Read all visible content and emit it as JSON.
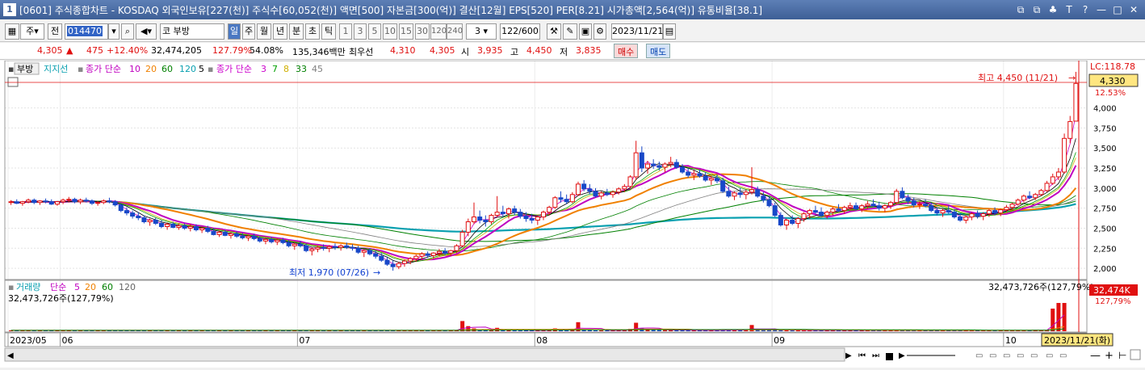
{
  "window": {
    "title": "[0601] 주식종합차트 - KOSDAQ 외국인보유[227(천)] 주식수[60,052(천)] 액면[500] 자본금[300(억)] 결산[12월] EPS[520] PER[8.21] 시가총액[2,564(억)] 유통비율[38.1]",
    "icon_label": "1",
    "buttons": [
      "⧉",
      "⧉",
      "♣",
      "T",
      "?",
      "—",
      "□",
      "✕"
    ]
  },
  "toolbar": {
    "chart_type": "주",
    "scope": "전",
    "code": "014470",
    "name_prefix": "코",
    "name": "부방",
    "periods": [
      "일",
      "주",
      "월",
      "년",
      "분",
      "초",
      "틱"
    ],
    "active_period": "일",
    "intervals": [
      "1",
      "3",
      "5",
      "10",
      "15",
      "30",
      "120",
      "240"
    ],
    "interval_value": "3",
    "count": "122",
    "count_total": "/600",
    "date": "2023/11/21"
  },
  "quote": {
    "price": "4,305",
    "arrow": "▲",
    "change": "475",
    "rate": "+12.40%",
    "volume": "32,474,205",
    "vol_rate": "127.79%",
    "ratio": "54.08%",
    "amount": "135,346백만",
    "pref_label": "최우선",
    "ask": "4,310",
    "bid": "4,305",
    "open_label": "시",
    "open": "3,935",
    "high_label": "고",
    "high": "4,450",
    "low_label": "저",
    "low": "3,835",
    "buy": "매수",
    "sell": "매도"
  },
  "legend": {
    "name": "부방",
    "support": "지지선",
    "ma1_title": "종가 단순",
    "ma1_periods": [
      "10",
      "20",
      "60",
      "120",
      "5"
    ],
    "ma2_title": "종가 단순",
    "ma2_periods": [
      "3",
      "7",
      "8",
      "33",
      "45"
    ]
  },
  "annotations": {
    "high": "최고 4,450 (11/21)",
    "low": "최저 1,970 (07/26)",
    "lc": "LC:118.78",
    "price_tag": "4,330",
    "pct": "12.53%",
    "vol_value": "32,473,726주(127,79%)",
    "vol_tag": "32,474K",
    "vol_pct": "127,79%",
    "cursor_date": "2023/11/21(화)"
  },
  "volume_panel": {
    "title": "거래량",
    "ma_title": "단순",
    "periods": [
      "5",
      "20",
      "60",
      "120"
    ],
    "readout": "32,473,726주(127,79%)"
  },
  "colors": {
    "up": "#e01010",
    "down": "#1848c8",
    "ma5": "#000000",
    "ma10": "#c000c0",
    "ma20": "#f08000",
    "ma60": "#008000",
    "ma120": "#0aa0b0",
    "ma_thin1": "#cc00cc",
    "ma_thin2": "#00a000",
    "ma_thin3": "#d0b000",
    "ma_thin4": "#008000",
    "ma_thin5": "#808080"
  },
  "chart_data": {
    "type": "candlestick",
    "y_ticks": [
      "4,000",
      "3,750",
      "3,500",
      "3,250",
      "3,000",
      "2,750",
      "2,500",
      "2,250",
      "2,000"
    ],
    "y_values": [
      4000,
      3750,
      3500,
      3250,
      3000,
      2750,
      2500,
      2250,
      2000
    ],
    "ylim": [
      1890,
      4560
    ],
    "x_labels": [
      "2023/05",
      "06",
      "07",
      "08",
      "09",
      "10",
      "11"
    ],
    "x_label_index": [
      0,
      9,
      50,
      91,
      132,
      172,
      208
    ],
    "candles": [
      [
        2820,
        2850,
        2790,
        2830
      ],
      [
        2830,
        2860,
        2800,
        2810
      ],
      [
        2810,
        2840,
        2780,
        2830
      ],
      [
        2830,
        2870,
        2810,
        2850
      ],
      [
        2850,
        2870,
        2800,
        2820
      ],
      [
        2820,
        2850,
        2790,
        2840
      ],
      [
        2840,
        2870,
        2810,
        2830
      ],
      [
        2830,
        2860,
        2790,
        2800
      ],
      [
        2800,
        2840,
        2780,
        2830
      ],
      [
        2830,
        2870,
        2800,
        2850
      ],
      [
        2850,
        2890,
        2820,
        2860
      ],
      [
        2860,
        2880,
        2810,
        2830
      ],
      [
        2830,
        2870,
        2800,
        2850
      ],
      [
        2850,
        2880,
        2820,
        2840
      ],
      [
        2840,
        2860,
        2790,
        2810
      ],
      [
        2810,
        2840,
        2780,
        2820
      ],
      [
        2820,
        2860,
        2800,
        2840
      ],
      [
        2840,
        2880,
        2810,
        2830
      ],
      [
        2830,
        2850,
        2770,
        2790
      ],
      [
        2790,
        2810,
        2700,
        2720
      ],
      [
        2720,
        2760,
        2660,
        2690
      ],
      [
        2690,
        2720,
        2620,
        2650
      ],
      [
        2650,
        2700,
        2600,
        2630
      ],
      [
        2630,
        2660,
        2560,
        2580
      ],
      [
        2580,
        2620,
        2530,
        2600
      ],
      [
        2600,
        2630,
        2540,
        2560
      ],
      [
        2560,
        2600,
        2500,
        2520
      ],
      [
        2520,
        2570,
        2480,
        2550
      ],
      [
        2550,
        2580,
        2500,
        2510
      ],
      [
        2510,
        2560,
        2480,
        2530
      ],
      [
        2530,
        2560,
        2480,
        2500
      ],
      [
        2500,
        2550,
        2460,
        2520
      ],
      [
        2520,
        2550,
        2460,
        2480
      ],
      [
        2480,
        2520,
        2440,
        2500
      ],
      [
        2500,
        2530,
        2440,
        2460
      ],
      [
        2460,
        2500,
        2410,
        2420
      ],
      [
        2420,
        2470,
        2390,
        2450
      ],
      [
        2450,
        2480,
        2400,
        2410
      ],
      [
        2410,
        2450,
        2370,
        2430
      ],
      [
        2430,
        2460,
        2380,
        2400
      ],
      [
        2400,
        2440,
        2360,
        2380
      ],
      [
        2380,
        2420,
        2340,
        2400
      ],
      [
        2400,
        2430,
        2350,
        2370
      ],
      [
        2370,
        2400,
        2320,
        2340
      ],
      [
        2340,
        2380,
        2300,
        2360
      ],
      [
        2360,
        2390,
        2310,
        2330
      ],
      [
        2330,
        2370,
        2290,
        2350
      ],
      [
        2350,
        2380,
        2300,
        2320
      ],
      [
        2320,
        2350,
        2260,
        2280
      ],
      [
        2280,
        2320,
        2230,
        2300
      ],
      [
        2300,
        2340,
        2260,
        2280
      ],
      [
        2280,
        2310,
        2200,
        2220
      ],
      [
        2220,
        2260,
        2160,
        2240
      ],
      [
        2240,
        2280,
        2200,
        2260
      ],
      [
        2260,
        2300,
        2220,
        2250
      ],
      [
        2250,
        2290,
        2200,
        2270
      ],
      [
        2270,
        2310,
        2230,
        2260
      ],
      [
        2260,
        2300,
        2220,
        2280
      ],
      [
        2280,
        2320,
        2240,
        2260
      ],
      [
        2260,
        2300,
        2220,
        2250
      ],
      [
        2250,
        2280,
        2180,
        2200
      ],
      [
        2200,
        2240,
        2140,
        2220
      ],
      [
        2220,
        2250,
        2160,
        2180
      ],
      [
        2180,
        2220,
        2120,
        2150
      ],
      [
        2150,
        2190,
        2080,
        2100
      ],
      [
        2100,
        2140,
        2030,
        2050
      ],
      [
        2050,
        2100,
        1970,
        2020
      ],
      [
        2020,
        2080,
        1990,
        2060
      ],
      [
        2060,
        2110,
        2020,
        2090
      ],
      [
        2090,
        2140,
        2050,
        2120
      ],
      [
        2120,
        2170,
        2080,
        2150
      ],
      [
        2150,
        2200,
        2110,
        2180
      ],
      [
        2180,
        2210,
        2130,
        2160
      ],
      [
        2160,
        2200,
        2120,
        2190
      ],
      [
        2190,
        2240,
        2150,
        2210
      ],
      [
        2210,
        2250,
        2160,
        2190
      ],
      [
        2190,
        2230,
        2150,
        2220
      ],
      [
        2220,
        2300,
        2190,
        2280
      ],
      [
        2280,
        2480,
        2260,
        2450
      ],
      [
        2450,
        2620,
        2400,
        2580
      ],
      [
        2580,
        2820,
        2550,
        2640
      ],
      [
        2640,
        2720,
        2560,
        2600
      ],
      [
        2600,
        2660,
        2520,
        2580
      ],
      [
        2580,
        2680,
        2550,
        2660
      ],
      [
        2660,
        2900,
        2640,
        2700
      ],
      [
        2700,
        2780,
        2640,
        2680
      ],
      [
        2680,
        2760,
        2620,
        2740
      ],
      [
        2740,
        2780,
        2660,
        2700
      ],
      [
        2700,
        2740,
        2620,
        2650
      ],
      [
        2650,
        2700,
        2580,
        2620
      ],
      [
        2620,
        2680,
        2560,
        2600
      ],
      [
        2600,
        2660,
        2540,
        2640
      ],
      [
        2640,
        2720,
        2600,
        2700
      ],
      [
        2700,
        2780,
        2660,
        2760
      ],
      [
        2760,
        2900,
        2740,
        2880
      ],
      [
        2880,
        2960,
        2820,
        2860
      ],
      [
        2860,
        2920,
        2800,
        2830
      ],
      [
        2830,
        2950,
        2810,
        2920
      ],
      [
        2920,
        3080,
        2900,
        3050
      ],
      [
        3050,
        3100,
        2960,
        2990
      ],
      [
        2990,
        3050,
        2920,
        2960
      ],
      [
        2960,
        3000,
        2880,
        2900
      ],
      [
        2900,
        2960,
        2860,
        2940
      ],
      [
        2940,
        2990,
        2900,
        2920
      ],
      [
        2920,
        2970,
        2880,
        2950
      ],
      [
        2950,
        3010,
        2920,
        2990
      ],
      [
        2990,
        3050,
        2950,
        3020
      ],
      [
        3020,
        3160,
        3000,
        3140
      ],
      [
        3140,
        3590,
        3100,
        3440
      ],
      [
        3440,
        3520,
        3200,
        3250
      ],
      [
        3250,
        3340,
        3180,
        3300
      ],
      [
        3300,
        3360,
        3240,
        3280
      ],
      [
        3280,
        3330,
        3220,
        3260
      ],
      [
        3260,
        3320,
        3200,
        3300
      ],
      [
        3300,
        3390,
        3260,
        3320
      ],
      [
        3320,
        3360,
        3240,
        3260
      ],
      [
        3260,
        3300,
        3180,
        3200
      ],
      [
        3200,
        3250,
        3130,
        3160
      ],
      [
        3160,
        3220,
        3100,
        3180
      ],
      [
        3180,
        3230,
        3130,
        3150
      ],
      [
        3150,
        3200,
        3080,
        3100
      ],
      [
        3100,
        3150,
        3040,
        3120
      ],
      [
        3120,
        3170,
        3060,
        3090
      ],
      [
        3090,
        3130,
        2940,
        2960
      ],
      [
        2960,
        3020,
        2880,
        2900
      ],
      [
        2900,
        2960,
        2850,
        2940
      ],
      [
        2940,
        3000,
        2880,
        2920
      ],
      [
        2920,
        2980,
        2860,
        2950
      ],
      [
        2950,
        3260,
        2920,
        2980
      ],
      [
        2980,
        3020,
        2880,
        2900
      ],
      [
        2900,
        2950,
        2820,
        2850
      ],
      [
        2850,
        2900,
        2760,
        2780
      ],
      [
        2780,
        2820,
        2640,
        2660
      ],
      [
        2660,
        2700,
        2520,
        2540
      ],
      [
        2540,
        2620,
        2480,
        2600
      ],
      [
        2600,
        2660,
        2540,
        2560
      ],
      [
        2560,
        2640,
        2500,
        2620
      ],
      [
        2620,
        2700,
        2580,
        2680
      ],
      [
        2680,
        2740,
        2620,
        2720
      ],
      [
        2720,
        2780,
        2680,
        2700
      ],
      [
        2700,
        2760,
        2640,
        2660
      ],
      [
        2660,
        2720,
        2620,
        2700
      ],
      [
        2700,
        2760,
        2660,
        2740
      ],
      [
        2740,
        2800,
        2700,
        2720
      ],
      [
        2720,
        2780,
        2680,
        2760
      ],
      [
        2760,
        2820,
        2720,
        2780
      ],
      [
        2780,
        2820,
        2720,
        2740
      ],
      [
        2740,
        2800,
        2700,
        2780
      ],
      [
        2780,
        2840,
        2740,
        2800
      ],
      [
        2800,
        2860,
        2760,
        2780
      ],
      [
        2780,
        2830,
        2720,
        2750
      ],
      [
        2750,
        2800,
        2700,
        2780
      ],
      [
        2780,
        2840,
        2740,
        2820
      ],
      [
        2820,
        2990,
        2800,
        2960
      ],
      [
        2960,
        3010,
        2860,
        2880
      ],
      [
        2880,
        2920,
        2800,
        2840
      ],
      [
        2840,
        2880,
        2760,
        2790
      ],
      [
        2790,
        2840,
        2740,
        2800
      ],
      [
        2800,
        2860,
        2760,
        2780
      ],
      [
        2780,
        2820,
        2700,
        2720
      ],
      [
        2720,
        2760,
        2660,
        2690
      ],
      [
        2690,
        2740,
        2640,
        2720
      ],
      [
        2720,
        2780,
        2680,
        2700
      ],
      [
        2700,
        2740,
        2620,
        2640
      ],
      [
        2640,
        2680,
        2580,
        2600
      ],
      [
        2600,
        2660,
        2560,
        2640
      ],
      [
        2640,
        2700,
        2600,
        2680
      ],
      [
        2680,
        2720,
        2620,
        2650
      ],
      [
        2650,
        2700,
        2600,
        2680
      ],
      [
        2680,
        2740,
        2640,
        2720
      ],
      [
        2720,
        2760,
        2660,
        2690
      ],
      [
        2690,
        2740,
        2650,
        2730
      ],
      [
        2730,
        2790,
        2700,
        2760
      ],
      [
        2760,
        2820,
        2730,
        2800
      ],
      [
        2800,
        2870,
        2780,
        2850
      ],
      [
        2850,
        2920,
        2820,
        2900
      ],
      [
        2900,
        2960,
        2860,
        2880
      ],
      [
        2880,
        2940,
        2850,
        2920
      ],
      [
        2920,
        2990,
        2900,
        2970
      ],
      [
        2970,
        3090,
        2950,
        3060
      ],
      [
        3060,
        3180,
        3040,
        3140
      ],
      [
        3140,
        3250,
        3100,
        3200
      ],
      [
        3200,
        3680,
        3180,
        3620
      ],
      [
        3620,
        3900,
        3560,
        3830
      ],
      [
        3835,
        4450,
        3935,
        4305
      ]
    ],
    "volumes": [
      0.3,
      0.3,
      0.3,
      0.3,
      0.3,
      0.3,
      0.3,
      0.3,
      0.3,
      0.3,
      0.3,
      0.3,
      0.3,
      0.3,
      0.3,
      0.3,
      0.3,
      0.3,
      0.3,
      0.3,
      0.3,
      0.3,
      0.3,
      0.3,
      0.3,
      0.3,
      0.3,
      0.3,
      0.3,
      0.3,
      0.3,
      0.3,
      0.3,
      0.3,
      0.3,
      0.3,
      0.3,
      0.3,
      0.3,
      0.3,
      0.3,
      0.3,
      0.3,
      0.3,
      0.3,
      0.3,
      0.3,
      0.3,
      0.3,
      0.3,
      0.3,
      0.3,
      0.3,
      0.3,
      0.3,
      0.3,
      0.3,
      0.3,
      0.3,
      0.3,
      0.3,
      0.3,
      0.3,
      0.3,
      0.3,
      0.3,
      0.3,
      0.3,
      0.3,
      0.3,
      0.3,
      0.3,
      0.3,
      0.3,
      0.3,
      0.3,
      0.3,
      0.3,
      3.6,
      1.8,
      1.0,
      0.5,
      0.4,
      0.4,
      1.2,
      0.5,
      0.4,
      0.4,
      0.3,
      0.3,
      0.3,
      0.3,
      0.4,
      0.4,
      1.0,
      0.5,
      0.4,
      0.5,
      3.2,
      0.6,
      0.4,
      0.3,
      0.3,
      0.3,
      0.3,
      0.4,
      0.4,
      0.8,
      3.0,
      1.0,
      0.5,
      0.4,
      0.4,
      0.4,
      0.5,
      0.4,
      0.4,
      0.3,
      0.3,
      0.3,
      0.3,
      0.3,
      0.3,
      0.6,
      0.4,
      0.4,
      0.4,
      0.4,
      2.2,
      0.5,
      0.4,
      0.4,
      0.6,
      0.5,
      0.4,
      0.3,
      0.3,
      0.3,
      0.3,
      0.3,
      0.3,
      0.3,
      0.3,
      0.3,
      0.3,
      0.3,
      0.3,
      0.3,
      0.3,
      0.3,
      0.3,
      0.6,
      0.4,
      0.3,
      0.3,
      0.3,
      0.3,
      0.3,
      0.3,
      0.3,
      0.3,
      0.3,
      0.3,
      0.3,
      0.3,
      0.3,
      0.3,
      0.3,
      0.3,
      0.3,
      0.3,
      0.3,
      0.3,
      0.3,
      0.3,
      0.3,
      0.3,
      0.5,
      0.4,
      0.4,
      8.0,
      10.0,
      10.0
    ]
  }
}
